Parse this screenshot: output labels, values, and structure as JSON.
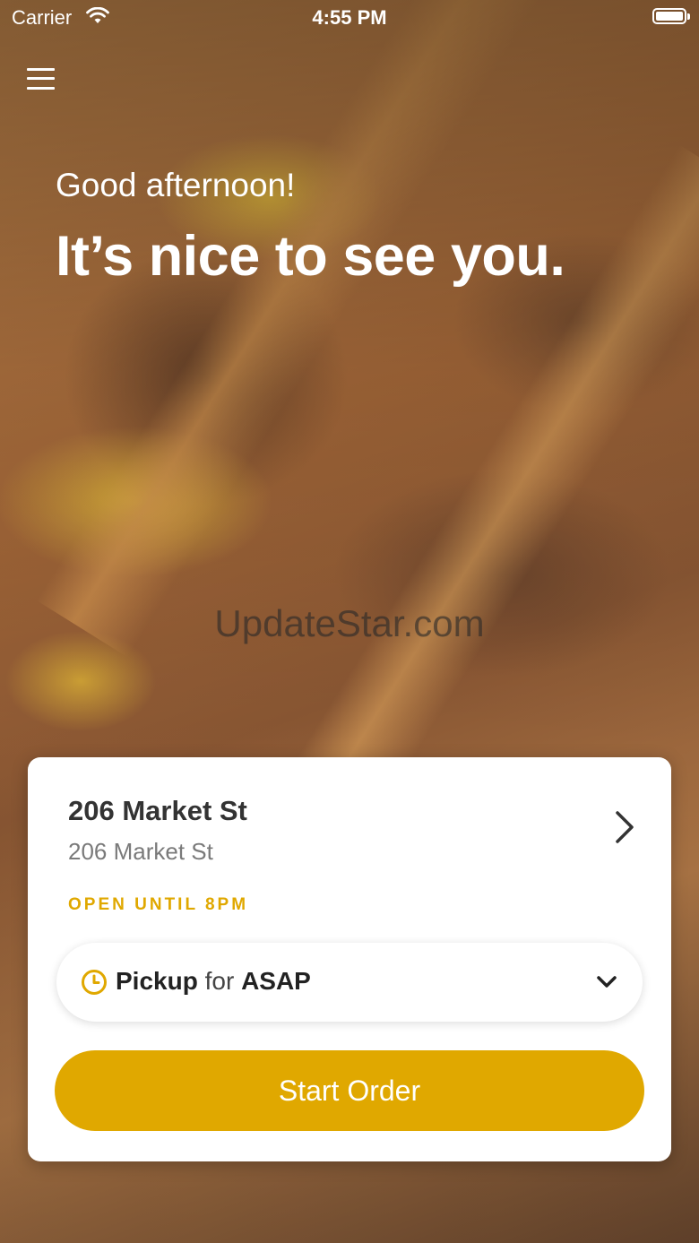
{
  "status_bar": {
    "carrier": "Carrier",
    "time": "4:55 PM"
  },
  "greeting": {
    "line1": "Good afternoon!",
    "line2": "It’s nice to see you."
  },
  "watermark": "UpdateStar.com",
  "location": {
    "name": "206 Market St",
    "address": "206 Market St",
    "open_status": "OPEN UNTIL 8PM"
  },
  "order_mode": {
    "mode": "Pickup",
    "connector": "for",
    "time": "ASAP"
  },
  "start_button": "Start Order",
  "colors": {
    "accent": "#e0a800",
    "card": "#ffffff",
    "text_dark": "#333333",
    "text_muted": "#7a7a7a"
  }
}
